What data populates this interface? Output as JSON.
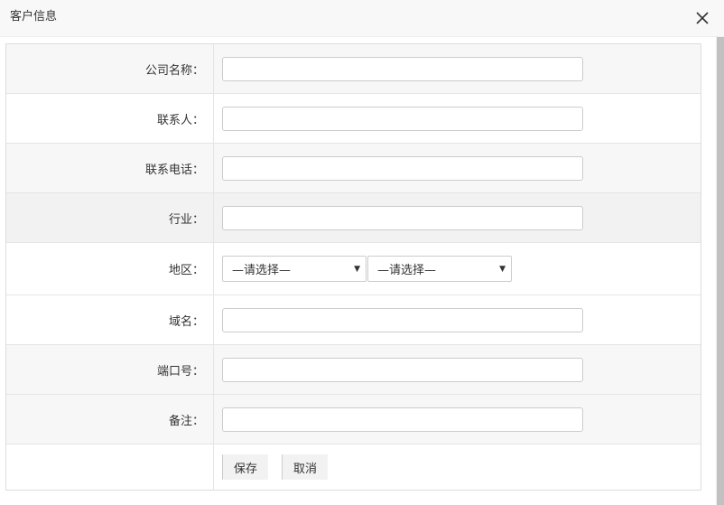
{
  "dialog": {
    "title": "客户信息"
  },
  "form": {
    "company_name": {
      "label": "公司名称：",
      "value": ""
    },
    "contact": {
      "label": "联系人：",
      "value": ""
    },
    "phone": {
      "label": "联系电话：",
      "value": ""
    },
    "industry": {
      "label": "行业：",
      "value": ""
    },
    "region": {
      "label": "地区：",
      "select1": "—请选择—",
      "select2": "—请选择—"
    },
    "domain": {
      "label": "域名：",
      "value": ""
    },
    "port": {
      "label": "端口号：",
      "value": ""
    },
    "remark": {
      "label": "备注：",
      "value": ""
    }
  },
  "actions": {
    "save_label": "保存",
    "cancel_label": "取消"
  },
  "icons": {
    "close": "close-icon",
    "dropdown": "chevron-down-icon"
  }
}
